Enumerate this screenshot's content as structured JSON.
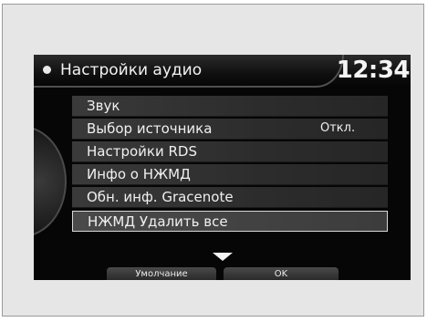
{
  "header": {
    "title": "Настройки аудио",
    "clock": "12:34"
  },
  "menu": {
    "items": [
      {
        "label": "Звук"
      },
      {
        "label": "Выбор источника",
        "value": "Откл."
      },
      {
        "label": "Настройки RDS"
      },
      {
        "label": "Инфо о НЖМД"
      },
      {
        "label": "Обн. инф. Gracenote"
      },
      {
        "label": "НЖМД Удалить все",
        "selected": true
      }
    ]
  },
  "softkeys": {
    "default_label": "Умолчание",
    "ok_label": "OK"
  },
  "icons": {
    "scroll_indicator": "chevron-down-icon",
    "title_bullet": "bullet-icon"
  },
  "colors": {
    "screen_background": "#060606",
    "text": "#f0f0f0",
    "selection_border": "#d8d8d8"
  }
}
